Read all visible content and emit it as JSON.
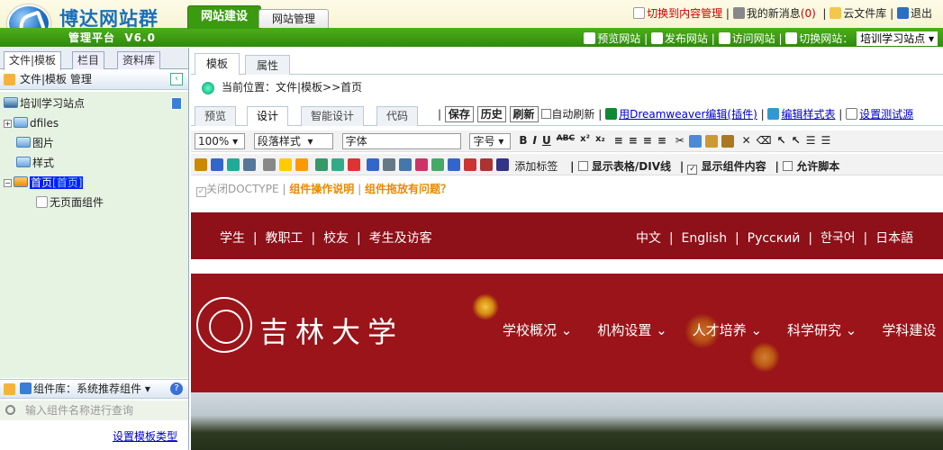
{
  "header": {
    "brand": "博达网站群",
    "platform": "管理平台",
    "version": "V6.0",
    "tabs": [
      "网站建设",
      "网站管理"
    ],
    "links": [
      "切换到内容管理",
      "我的新消息",
      "(0)",
      "云文件库",
      "退出"
    ],
    "subnav": [
      "预览网站",
      "发布网站",
      "访问网站",
      "切换网站："
    ],
    "current_site": "培训学习站点"
  },
  "sidebar": {
    "tabs": [
      "文件|模板",
      "栏目",
      "资料库"
    ],
    "title": "文件|模板 管理",
    "tree": [
      {
        "label": "培训学习站点"
      },
      {
        "label": "dfiles"
      },
      {
        "label": "图片"
      },
      {
        "label": "样式"
      },
      {
        "label": "首页",
        "suffix": "[首页]"
      },
      {
        "label": "无页面组件"
      }
    ],
    "component_lib": "组件库：系统推荐组件",
    "search_placeholder": "输入组件名称进行查询",
    "set_template_link": "设置模板类型"
  },
  "main": {
    "tabs": [
      "模板",
      "属性"
    ],
    "breadcrumb": "当前位置：文件|模板>>首页",
    "editor_tabs": [
      "预览",
      "设计",
      "智能设计",
      "代码"
    ],
    "actions": [
      "保存",
      "历史",
      "刷新"
    ],
    "auto_refresh": "自动刷新",
    "dw_link": "用Dreamweaver编辑",
    "dw_plugin": "(插件)",
    "style_link": "编辑样式表",
    "test_link": "设置测试源",
    "zoom": "100%",
    "para_style": "段落样式",
    "font": "字体",
    "font_size": "字号",
    "add_tag": "添加标签",
    "show_table": "显示表格/DIV线",
    "show_component": "显示组件内容",
    "allow_script": "允许脚本",
    "close_doctype": "关闭DOCTYPE",
    "op_help": "组件操作说明",
    "drag_help": "组件拖放有问题？"
  },
  "preview": {
    "nav_left": [
      "学生",
      "|",
      "教职工",
      "|",
      "校友",
      "|",
      "考生及访客"
    ],
    "nav_right": [
      "中文",
      "|",
      "English",
      "|",
      "Русский",
      "|",
      "한국어",
      "|",
      "日本語"
    ],
    "university": "吉林大学",
    "menu": [
      "学校概况 ⌄",
      "机构设置 ⌄",
      "人才培养 ⌄",
      "科学研究 ⌄",
      "学科建设"
    ]
  },
  "colors": {
    "accent_green": "#3a9a10",
    "banner_red": "#9a1419",
    "selection": "#001eff"
  }
}
